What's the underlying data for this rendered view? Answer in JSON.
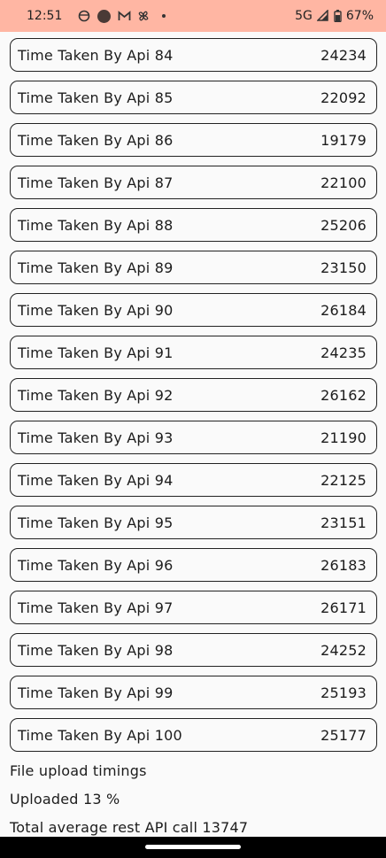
{
  "status_bar": {
    "time": "12:51",
    "network": "5G",
    "battery": "67%",
    "icons": [
      "face-icon",
      "record-icon",
      "gmail-icon",
      "pinwheel-icon",
      "notification-dot-icon",
      "signal-icon",
      "battery-icon"
    ]
  },
  "rows": [
    {
      "label": "Time Taken By Api 84",
      "value": "24234"
    },
    {
      "label": "Time Taken By Api 85",
      "value": "22092"
    },
    {
      "label": "Time Taken By Api 86",
      "value": "19179"
    },
    {
      "label": "Time Taken By Api 87",
      "value": "22100"
    },
    {
      "label": "Time Taken By Api 88",
      "value": "25206"
    },
    {
      "label": "Time Taken By Api 89",
      "value": "23150"
    },
    {
      "label": "Time Taken By Api 90",
      "value": "26184"
    },
    {
      "label": "Time Taken By Api 91",
      "value": "24235"
    },
    {
      "label": "Time Taken By Api 92",
      "value": "26162"
    },
    {
      "label": "Time Taken By Api 93",
      "value": "21190"
    },
    {
      "label": "Time Taken By Api 94",
      "value": "22125"
    },
    {
      "label": "Time Taken By Api 95",
      "value": "23151"
    },
    {
      "label": "Time Taken By Api 96",
      "value": "26183"
    },
    {
      "label": "Time Taken By Api 97",
      "value": "26171"
    },
    {
      "label": "Time Taken By Api 98",
      "value": "24252"
    },
    {
      "label": "Time Taken By Api 99",
      "value": "25193"
    },
    {
      "label": "Time Taken By Api 100",
      "value": "25177"
    }
  ],
  "footer": {
    "section_title": "File upload timings",
    "uploaded": "Uploaded 13 %",
    "average": "Total average rest API call 13747"
  }
}
